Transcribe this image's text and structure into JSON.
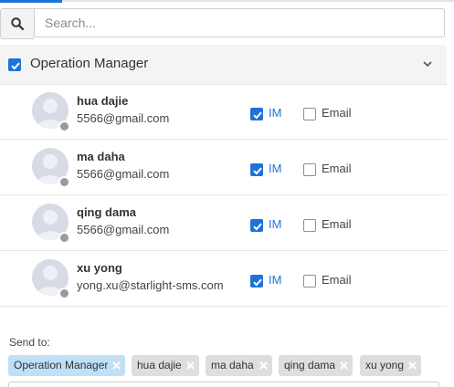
{
  "search": {
    "placeholder": "Search..."
  },
  "group": {
    "label": "Operation Manager",
    "checked": true
  },
  "contacts": [
    {
      "name": "hua dajie",
      "email": "5566@gmail.com",
      "im_label": "IM",
      "email_label": "Email",
      "im_checked": true,
      "email_checked": false
    },
    {
      "name": "ma daha",
      "email": "5566@gmail.com",
      "im_label": "IM",
      "email_label": "Email",
      "im_checked": true,
      "email_checked": false
    },
    {
      "name": "qing dama",
      "email": "5566@gmail.com",
      "im_label": "IM",
      "email_label": "Email",
      "im_checked": true,
      "email_checked": false
    },
    {
      "name": "xu yong",
      "email": "yong.xu@starlight-sms.com",
      "im_label": "IM",
      "email_label": "Email",
      "im_checked": true,
      "email_checked": false
    }
  ],
  "send_to": {
    "label": "Send to:",
    "chips": [
      "Operation Manager",
      "hua dajie",
      "ma daha",
      "qing dama",
      "xu yong"
    ]
  },
  "colors": {
    "accent": "#1e73d9",
    "chip_primary": "#bfe0f7",
    "chip": "#dedede"
  }
}
